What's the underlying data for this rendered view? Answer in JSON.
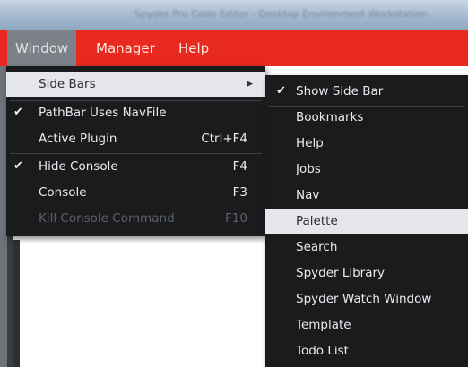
{
  "window_title": "Spyder Pro Code Editor - Desktop Environment Workstation",
  "menubar": {
    "items": [
      "Window",
      "Manager",
      "Help"
    ],
    "active_index": 0
  },
  "window_menu": {
    "items": [
      {
        "label": "Side Bars",
        "checked": false,
        "shortcut": "",
        "has_submenu": true,
        "highlighted": true,
        "disabled": false
      },
      {
        "label": "PathBar Uses NavFile",
        "checked": true,
        "shortcut": "",
        "has_submenu": false,
        "highlighted": false,
        "disabled": false
      },
      {
        "label": "Active Plugin",
        "checked": false,
        "shortcut": "Ctrl+F4",
        "has_submenu": false,
        "highlighted": false,
        "disabled": false
      },
      {
        "label": "Hide Console",
        "checked": true,
        "shortcut": "F4",
        "has_submenu": false,
        "highlighted": false,
        "disabled": false
      },
      {
        "label": "Console",
        "checked": false,
        "shortcut": "F3",
        "has_submenu": false,
        "highlighted": false,
        "disabled": false
      },
      {
        "label": "Kill Console Command",
        "checked": false,
        "shortcut": "F10",
        "has_submenu": false,
        "highlighted": false,
        "disabled": true
      }
    ]
  },
  "sidebars_menu": {
    "items": [
      {
        "label": "Show Side Bar",
        "checked": true,
        "highlighted": false
      },
      {
        "label": "Bookmarks",
        "checked": false,
        "highlighted": false
      },
      {
        "label": "Help",
        "checked": false,
        "highlighted": false
      },
      {
        "label": "Jobs",
        "checked": false,
        "highlighted": false
      },
      {
        "label": "Nav",
        "checked": false,
        "highlighted": false
      },
      {
        "label": "Palette",
        "checked": false,
        "highlighted": true
      },
      {
        "label": "Search",
        "checked": false,
        "highlighted": false
      },
      {
        "label": "Spyder Library",
        "checked": false,
        "highlighted": false
      },
      {
        "label": "Spyder Watch Window",
        "checked": false,
        "highlighted": false
      },
      {
        "label": "Template",
        "checked": false,
        "highlighted": false
      },
      {
        "label": "Todo List",
        "checked": false,
        "highlighted": false
      }
    ]
  },
  "icons": {
    "check": "check-icon",
    "submenu_arrow": "chevron-right-icon"
  },
  "colors": {
    "menubar_bg": "#e8291f",
    "active_menu_bg": "#7c8188",
    "dropdown_bg": "#1a1b1d",
    "highlight_bg": "#e4e6e9"
  }
}
